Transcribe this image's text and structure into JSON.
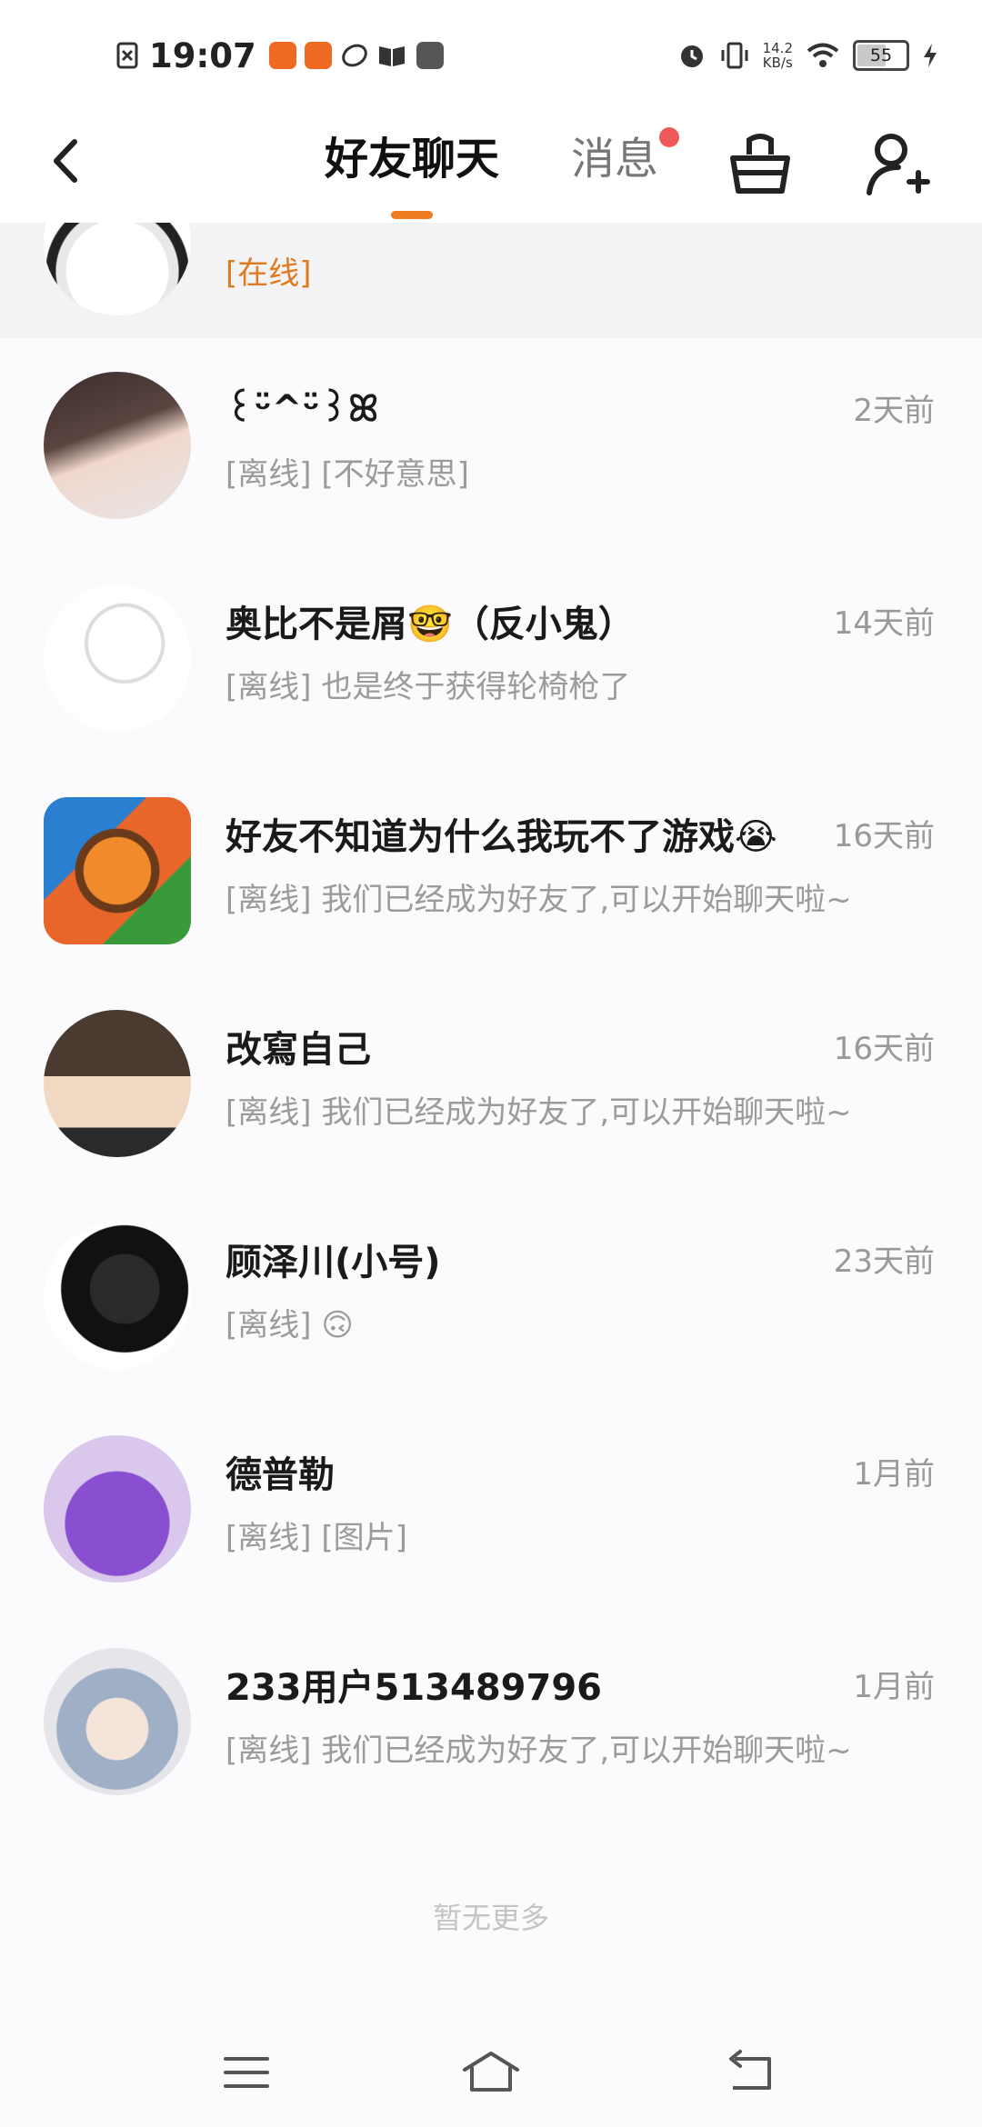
{
  "status_bar": {
    "time": "19:07",
    "net_speed_value": "14.2",
    "net_speed_unit": "KB/s",
    "battery": "55",
    "app_icons": [
      "notification-x-icon",
      "app-orange-icon",
      "app-orange-icon",
      "leaf-icon",
      "book-icon",
      "vivo-icon"
    ],
    "right_icons": [
      "alarm-icon",
      "vibrate-icon",
      "wifi-icon",
      "charging-icon"
    ]
  },
  "header": {
    "tab_friends": "好友聊天",
    "tab_messages": "消息",
    "accent_color": "#f07a1f",
    "badge_color": "#f15a5a"
  },
  "partial_row": {
    "status": "[在线]"
  },
  "conversations": [
    {
      "name": "꒰ᵕ̈^ᵕ̈꒱ꕤ",
      "time": "2天前",
      "preview": "[离线] [不好意思]"
    },
    {
      "name": "奥比不是屑🤓（反小鬼）",
      "time": "14天前",
      "preview": "[离线] 也是终于获得轮椅枪了"
    },
    {
      "name": "好友不知道为什么我玩不了游戏😭",
      "time": "16天前",
      "preview": "[离线] 我们已经成为好友了,可以开始聊天啦~"
    },
    {
      "name": "改寫自己",
      "time": "16天前",
      "preview": "[离线] 我们已经成为好友了,可以开始聊天啦~"
    },
    {
      "name": "顾泽川(小号)",
      "time": "23天前",
      "preview": "[离线] 🙃"
    },
    {
      "name": "德普勒",
      "time": "1月前",
      "preview": "[离线] [图片]"
    },
    {
      "name": "233用户513489796",
      "time": "1月前",
      "preview": "[离线] 我们已经成为好友了,可以开始聊天啦~"
    }
  ],
  "footer": {
    "no_more": "暂无更多"
  },
  "nav": [
    "menu-icon",
    "home-icon",
    "back-icon"
  ]
}
